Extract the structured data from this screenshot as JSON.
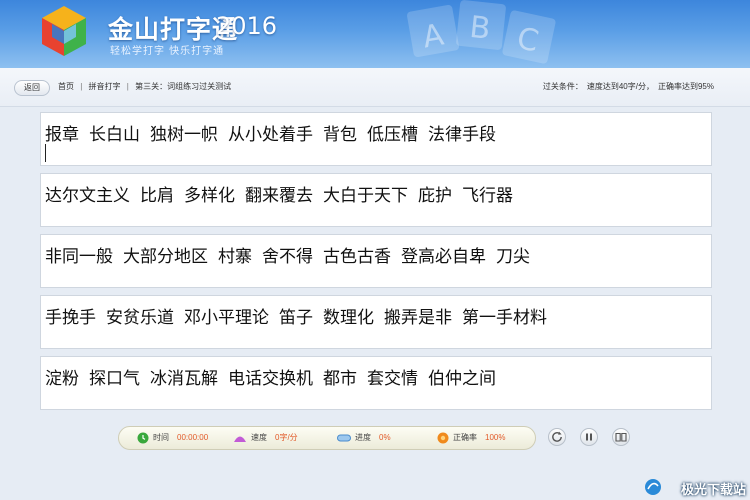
{
  "app": {
    "name": "金山打字通",
    "year": "2016",
    "slogan": "轻松学打字 快乐打字通"
  },
  "toolbar": {
    "back_label": "返回",
    "breadcrumb": [
      "首页",
      "拼音打字",
      "第三关：词组练习过关测试"
    ],
    "pass_condition_label": "过关条件：",
    "pass_condition_speed": "速度达到40字/分，",
    "pass_condition_accuracy": "正确率达到95%"
  },
  "lines": [
    [
      "报章",
      "长白山",
      "独树一帜",
      "从小处着手",
      "背包",
      "低压槽",
      "法律手段"
    ],
    [
      "达尔文主义",
      "比肩",
      "多样化",
      "翻来覆去",
      "大白于天下",
      "庇护",
      "飞行器"
    ],
    [
      "非同一般",
      "大部分地区",
      "村寨",
      "舍不得",
      "古色古香",
      "登高必自卑",
      "刀尖"
    ],
    [
      "手挽手",
      "安贫乐道",
      "邓小平理论",
      "笛子",
      "数理化",
      "搬弄是非",
      "第一手材料"
    ],
    [
      "淀粉",
      "探口气",
      "冰消瓦解",
      "电话交换机",
      "都市",
      "套交情",
      "伯仲之间"
    ]
  ],
  "status": {
    "time_label": "时间",
    "time_value": "00:00:00",
    "speed_label": "速度",
    "speed_value": "0字/分",
    "progress_label": "进度",
    "progress_value": "0%",
    "accuracy_label": "正确率",
    "accuracy_value": "100%"
  },
  "controls": {
    "restart_icon": "restart-icon",
    "pause_icon": "pause-icon",
    "book_icon": "book-icon"
  },
  "watermark": {
    "text": "极光下载站"
  },
  "colors": {
    "header": "#4a90e2",
    "value_accent": "#e25b2a"
  }
}
